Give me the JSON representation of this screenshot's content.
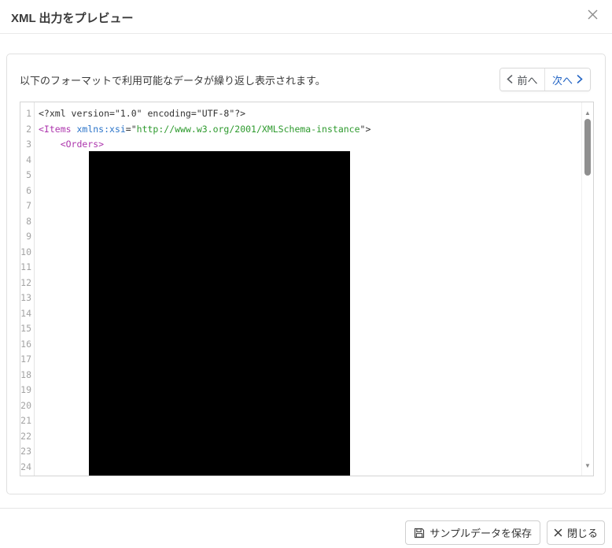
{
  "dialog_title": "XML 出力をプレビュー",
  "preview": {
    "description": "以下のフォーマットで利用可能なデータが繰り返し表示されます。",
    "pager": {
      "prev_label": "前へ",
      "next_label": "次へ"
    }
  },
  "editor": {
    "language": "xml",
    "visible_line_count": 24,
    "lines": [
      {
        "num": 1,
        "segments": [
          {
            "text": "<?xml version=\"1.0\" encoding=\"UTF-8\"?>",
            "style": "plain"
          }
        ]
      },
      {
        "num": 2,
        "segments": [
          {
            "text": "<Items",
            "style": "tag"
          },
          {
            "text": " ",
            "style": "plain"
          },
          {
            "text": "xmlns:xsi",
            "style": "attr"
          },
          {
            "text": "=\"",
            "style": "plain"
          },
          {
            "text": "http://www.w3.org/2001/XMLSchema-instance",
            "style": "string"
          },
          {
            "text": "\">",
            "style": "plain"
          }
        ]
      },
      {
        "num": 3,
        "segments": [
          {
            "text": "    <Orders>",
            "style": "tag"
          }
        ]
      }
    ],
    "redacted_region": true,
    "scrollbar": {
      "up_icon": "▲",
      "down_icon": "▼"
    }
  },
  "footer": {
    "save_button": {
      "icon": "floppy-disk-icon",
      "label": "サンプルデータを保存"
    },
    "close_button": {
      "icon": "x-icon",
      "label": "閉じる"
    }
  },
  "colors": {
    "accent_blue": "#2264c4",
    "syntax_tag": "#ad35ad",
    "syntax_attr": "#2b74c9",
    "syntax_string": "#2d9a2d",
    "syntax_plain": "#333333",
    "scrollbar_thumb": "#8f8f8f"
  }
}
